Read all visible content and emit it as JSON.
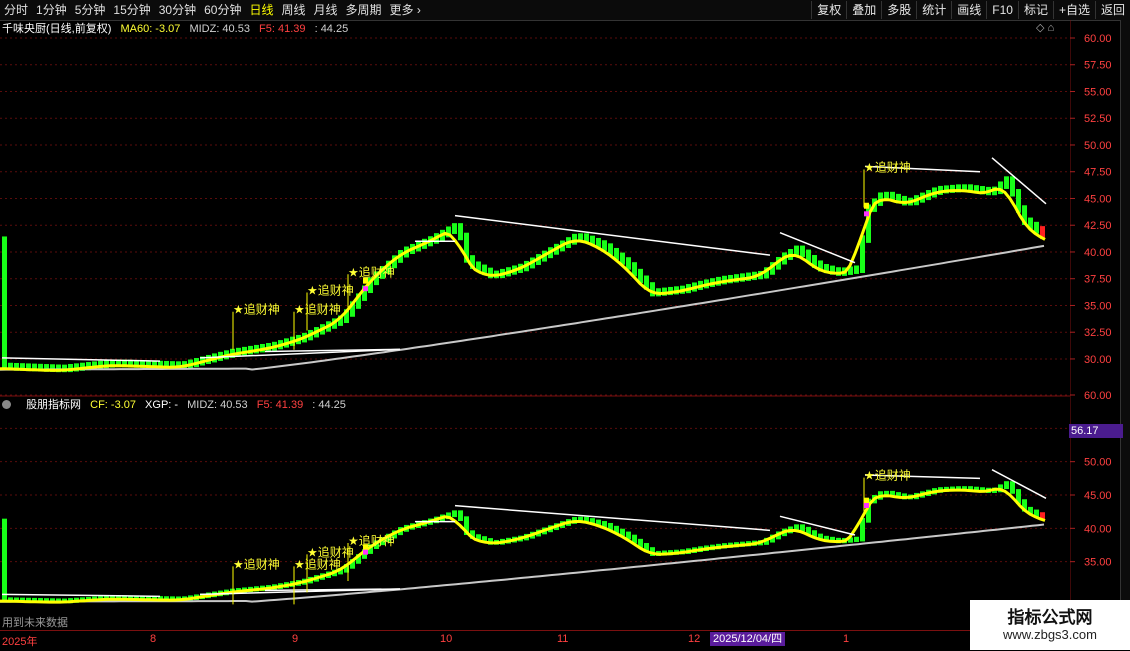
{
  "toolbar": {
    "periods": [
      "分时",
      "1分钟",
      "5分钟",
      "15分钟",
      "30分钟",
      "60分钟",
      "日线",
      "周线",
      "月线",
      "多周期",
      "更多"
    ],
    "active_index": 6,
    "more_arrow": "›",
    "buttons": [
      "复权",
      "叠加",
      "多股",
      "统计",
      "画线",
      "F10",
      "标记",
      "+自选",
      "返回"
    ]
  },
  "main_panel": {
    "title": "千味央厨(日线,前复权)",
    "ma60_label": "MA60: -3.07",
    "midz_label": "MIDZ: 40.53",
    "f5_label": "F5: 41.39",
    "extra_label": ": 44.25",
    "axis_ticks": [
      "60.00",
      "57.50",
      "55.00",
      "52.50",
      "50.00",
      "47.50",
      "45.00",
      "42.50",
      "40.00",
      "37.50",
      "35.00",
      "32.50",
      "30.00"
    ],
    "signal_text": "追财神",
    "corner_icons": "◇ ⌂"
  },
  "sub_panel": {
    "title": "股朋指标网",
    "cf_label": "CF: -3.07",
    "xgp_label": "XGP: -",
    "midz_label": "MIDZ: 40.53",
    "f5_label": "F5: 41.39",
    "extra_label": ": 44.25",
    "axis_ticks": [
      "60.00",
      "55.00",
      "50.00",
      "45.00",
      "40.00",
      "35.00"
    ],
    "price_box": "56.17",
    "signal_text": "追财神"
  },
  "date_axis": {
    "labels": [
      "2025年",
      "8",
      "9",
      "10",
      "11",
      "12",
      "1"
    ],
    "selected_date": "2025/12/04/四"
  },
  "footer": {
    "no_future_note": "用到未来数据"
  },
  "watermark": {
    "title": "指标公式网",
    "url": "www.zbgs3.com"
  },
  "colors": {
    "up": "#ff3030",
    "down": "#00ff3a",
    "ma": "#ffff00",
    "midline": "#c8c8c8",
    "trend": "#ffffff",
    "accent": "#ffff33"
  },
  "chart_data": {
    "type": "line",
    "series": [
      {
        "name": "MA60",
        "values": [
          29.2,
          29.3,
          29.4,
          29.6,
          29.8,
          30.2,
          30.6,
          31.2,
          31.9,
          32.7,
          33.5,
          34.3,
          35.0,
          35.6,
          36.1,
          36.6,
          37.1,
          37.6,
          38.0,
          38.4,
          38.8,
          39.3,
          39.8,
          40.3,
          40.5
        ]
      },
      {
        "name": "MIDZ",
        "values": [
          29.0,
          29.1,
          29.2,
          29.4,
          29.8,
          30.5,
          31.3,
          32.0,
          32.6,
          33.1,
          33.6,
          34.2,
          34.8,
          35.4,
          36.0,
          36.6,
          37.2,
          37.8,
          38.3,
          38.8,
          39.3,
          39.7,
          40.1,
          40.4,
          40.53
        ]
      },
      {
        "name": "F5",
        "values": [
          29.3,
          29.4,
          29.6,
          29.8,
          31.5,
          33.0,
          36.5,
          39.5,
          41.8,
          40.2,
          39.0,
          40.5,
          41.8,
          40.8,
          38.5,
          37.2,
          37.6,
          38.5,
          40.0,
          38.6,
          44.0,
          45.0,
          45.5,
          46.0,
          41.39
        ]
      }
    ],
    "ylim": [
      28.5,
      61
    ]
  }
}
